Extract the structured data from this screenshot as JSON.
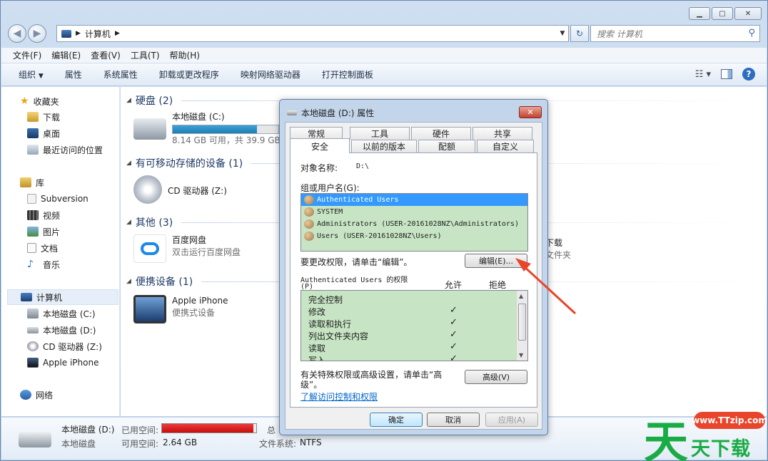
{
  "address": {
    "path": "计算机",
    "search_placeholder": "搜索 计算机"
  },
  "menu": [
    "文件(F)",
    "编辑(E)",
    "查看(V)",
    "工具(T)",
    "帮助(H)"
  ],
  "toolbar": [
    "组织",
    "属性",
    "系统属性",
    "卸载或更改程序",
    "映射网络驱动器",
    "打开控制面板"
  ],
  "sidebar": {
    "favorites": {
      "label": "收藏夹",
      "items": [
        "下载",
        "桌面",
        "最近访问的位置"
      ]
    },
    "libraries": {
      "label": "库",
      "items": [
        "Subversion",
        "视频",
        "图片",
        "文档",
        "音乐"
      ]
    },
    "computer": {
      "label": "计算机",
      "items": [
        "本地磁盘 (C:)",
        "本地磁盘 (D:)",
        "CD 驱动器 (Z:)",
        "Apple iPhone"
      ]
    },
    "network": {
      "label": "网络"
    }
  },
  "groups": {
    "hdd": {
      "label": "硬盘 (2)"
    },
    "removable": {
      "label": "有可移动存储的设备 (1)"
    },
    "other": {
      "label": "其他 (3)"
    },
    "portable": {
      "label": "便携设备 (1)"
    }
  },
  "tiles": {
    "c_drive": {
      "name": "本地磁盘 (C:)",
      "info": "8.14 GB 可用，共 39.9 GB",
      "used_fraction": 0.8
    },
    "cd_drive": {
      "name": "CD 驱动器 (Z:)"
    },
    "baidu": {
      "name": "百度网盘",
      "info": "双击运行百度网盘"
    },
    "partial_download": {
      "name": "下载",
      "info": "文件夹"
    },
    "iphone": {
      "name": "Apple iPhone",
      "info": "便携式设备"
    }
  },
  "status": {
    "drive_name": "本地磁盘 (D:)",
    "drive_type": "本地磁盘",
    "used_label": "已用空间:",
    "free_label": "可用空间:",
    "free_value": "2.64 GB",
    "total_label": "总",
    "fs_label": "文件系统:",
    "fs_value": "NTFS",
    "used_fraction": 0.97
  },
  "dialog": {
    "title": "本地磁盘 (D:) 属性",
    "close": "✕",
    "tabs_top": [
      "常规",
      "工具",
      "硬件",
      "共享"
    ],
    "tabs_bottom": [
      "安全",
      "以前的版本",
      "配额",
      "自定义"
    ],
    "object_label": "对象名称:",
    "object_value": "D:\\",
    "group_label": "组或用户名(G):",
    "users": [
      "Authenticated Users",
      "SYSTEM",
      "Administrators (USER-20161028NZ\\Administrators)",
      "Users (USER-20161028NZ\\Users)"
    ],
    "change_hint": "要更改权限，请单击“编辑”。",
    "edit_button": "编辑(E)...",
    "perm_label_line1": "Authenticated Users 的权限",
    "perm_label_line2": "(P)",
    "allow_header": "允许",
    "deny_header": "拒绝",
    "permissions": [
      {
        "name": "完全控制",
        "allow": ""
      },
      {
        "name": "修改",
        "allow": "✓"
      },
      {
        "name": "读取和执行",
        "allow": "✓"
      },
      {
        "name": "列出文件夹内容",
        "allow": "✓"
      },
      {
        "name": "读取",
        "allow": "✓"
      },
      {
        "name": "写入",
        "allow": "✓"
      }
    ],
    "advanced_hint_line1": "有关特殊权限或高级设置，请单击“高",
    "advanced_hint_line2": "级”。",
    "advanced_button": "高级(V)",
    "learn_link": "了解访问控制和权限",
    "ok": "确定",
    "cancel": "取消",
    "apply": "应用(A)"
  },
  "watermark": {
    "big1": "天",
    "bubble": "www.TTzip.com",
    "rest": "天下载"
  },
  "colors": {
    "selection": "#3399ff",
    "list_bg": "#c7e5c4",
    "arrow": "#e8452b",
    "watermark": "#1aab44"
  }
}
